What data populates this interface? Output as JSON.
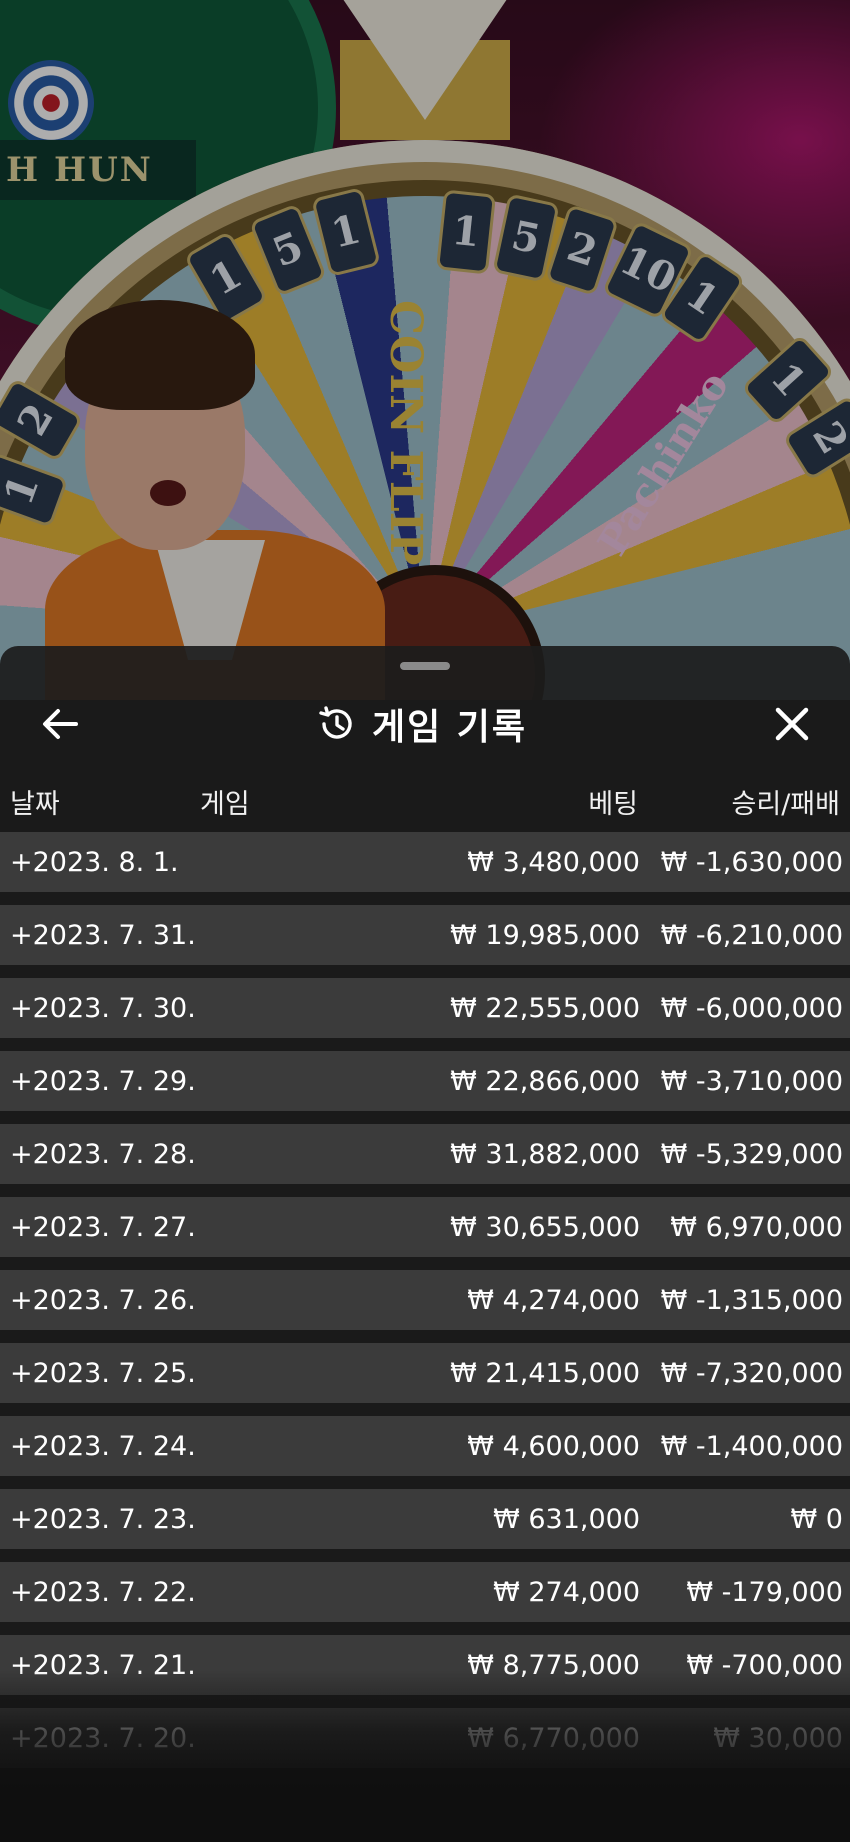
{
  "scene": {
    "sign_text": "H HUN",
    "wheel_labels": [
      "COIN FLIP",
      "Pachinko"
    ],
    "wheel_numbers": [
      "1",
      "5",
      "1",
      "1",
      "5",
      "2",
      "10",
      "1",
      "1",
      "2",
      "2",
      "1"
    ]
  },
  "header": {
    "title": "게임 기록",
    "back_icon": "arrow-left-icon",
    "close_icon": "close-icon",
    "history_icon": "history-icon"
  },
  "columns": {
    "date": "날짜",
    "game": "게임",
    "bet": "베팅",
    "result": "승리/패배"
  },
  "rows": [
    {
      "date": "+2023. 8. 1.",
      "bet": "₩ 3,480,000",
      "result": "₩ -1,630,000"
    },
    {
      "date": "+2023. 7. 31.",
      "bet": "₩ 19,985,000",
      "result": "₩ -6,210,000"
    },
    {
      "date": "+2023. 7. 30.",
      "bet": "₩ 22,555,000",
      "result": "₩ -6,000,000"
    },
    {
      "date": "+2023. 7. 29.",
      "bet": "₩ 22,866,000",
      "result": "₩ -3,710,000"
    },
    {
      "date": "+2023. 7. 28.",
      "bet": "₩ 31,882,000",
      "result": "₩ -5,329,000"
    },
    {
      "date": "+2023. 7. 27.",
      "bet": "₩ 30,655,000",
      "result": "₩ 6,970,000"
    },
    {
      "date": "+2023. 7. 26.",
      "bet": "₩ 4,274,000",
      "result": "₩ -1,315,000"
    },
    {
      "date": "+2023. 7. 25.",
      "bet": "₩ 21,415,000",
      "result": "₩ -7,320,000"
    },
    {
      "date": "+2023. 7. 24.",
      "bet": "₩ 4,600,000",
      "result": "₩ -1,400,000"
    },
    {
      "date": "+2023. 7. 23.",
      "bet": "₩ 631,000",
      "result": "₩ 0"
    },
    {
      "date": "+2023. 7. 22.",
      "bet": "₩ 274,000",
      "result": "₩ -179,000"
    },
    {
      "date": "+2023. 7. 21.",
      "bet": "₩ 8,775,000",
      "result": "₩ -700,000"
    },
    {
      "date": "+2023. 7. 20.",
      "bet": "₩ 6,770,000",
      "result": "₩ 30,000"
    }
  ],
  "colors": {
    "sheet_bg": "#1c1c1c",
    "row_bg": "#3b3b3b",
    "text": "#ffffff"
  }
}
